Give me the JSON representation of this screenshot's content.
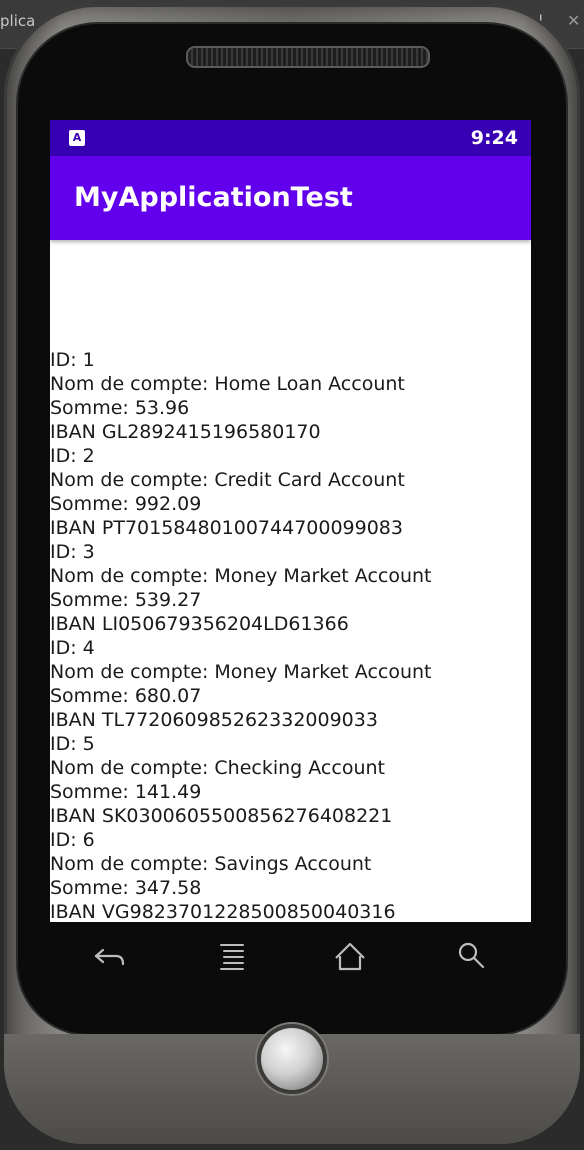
{
  "host": {
    "left_tab_fragment": "plica",
    "right_tab_fragment": "ml",
    "close_glyph": "✕"
  },
  "status_bar": {
    "app_icon_letter": "A",
    "time": "9:24"
  },
  "app_bar": {
    "title": "MyApplicationTest"
  },
  "accounts": [
    {
      "id_line": "ID: 1",
      "name_line": "Nom de compte: Home Loan Account",
      "sum_line": "Somme: 53.96",
      "iban_line": "IBAN GL2892415196580170"
    },
    {
      "id_line": "ID: 2",
      "name_line": "Nom de compte: Credit Card Account",
      "sum_line": "Somme: 992.09",
      "iban_line": "IBAN PT70158480100744700099083"
    },
    {
      "id_line": "ID: 3",
      "name_line": "Nom de compte: Money Market Account",
      "sum_line": "Somme: 539.27",
      "iban_line": "IBAN LI050679356204LD61366"
    },
    {
      "id_line": "ID: 4",
      "name_line": "Nom de compte: Money Market Account",
      "sum_line": "Somme: 680.07",
      "iban_line": "IBAN TL772060985262332009033"
    },
    {
      "id_line": "ID: 5",
      "name_line": "Nom de compte: Checking Account",
      "sum_line": "Somme: 141.49",
      "iban_line": "IBAN SK0300605500856276408221"
    },
    {
      "id_line": "ID: 6",
      "name_line": "Nom de compte: Savings Account",
      "sum_line": "Somme: 347.58",
      "iban_line": "IBAN VG9823701228500850040316"
    }
  ],
  "nav_icons": [
    "back-icon",
    "menu-icon",
    "home-icon",
    "search-icon"
  ],
  "colors": {
    "status_bar": "#3700b3",
    "app_bar": "#6200ee",
    "screen_background": "#ffffff",
    "text": "#1a1a1a"
  }
}
